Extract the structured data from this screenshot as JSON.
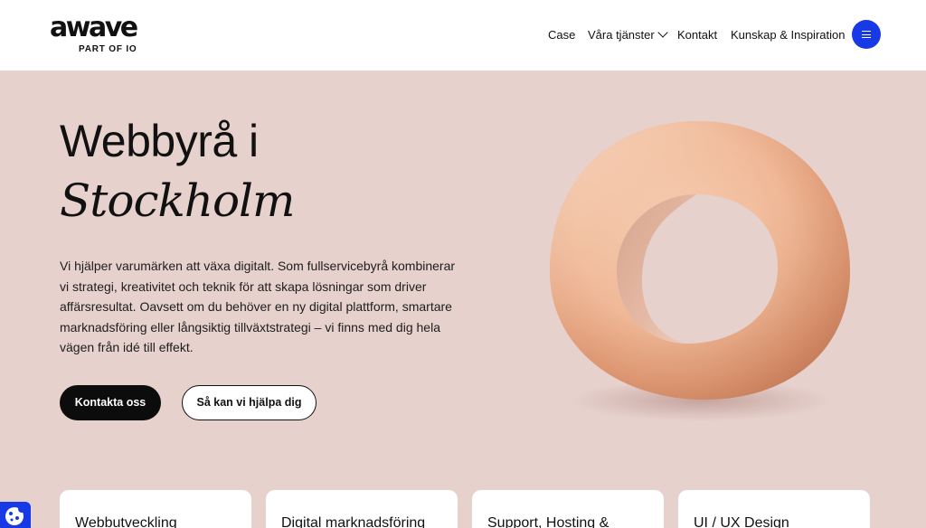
{
  "header": {
    "logo_word": "awave",
    "logo_sub": "PART OF IO",
    "nav": [
      {
        "label": "Case"
      },
      {
        "label": "Våra tjänster"
      },
      {
        "label": "Kontakt"
      },
      {
        "label": "Kunskap & Inspiration"
      }
    ],
    "menu_icon": "hamburger-icon"
  },
  "hero": {
    "title_line1": "Webbyrå i",
    "title_line2": "Stockholm",
    "text": "Vi hjälper varumärken att växa digitalt. Som fullservicebyrå kombinerar vi strategi, kreativitet och teknik för att skapa lösningar som driver affärsresultat. Oavsett om du behöver en ny digital plattform, smartare marknadsföring eller långsiktig tillväxtstrategi – vi finns med dig hela vägen från idé till effekt.",
    "primary_cta": "Kontakta oss",
    "secondary_cta": "Så kan vi hjälpa dig"
  },
  "cards": [
    {
      "title": "Webbutveckling"
    },
    {
      "title": "Digital marknadsföring"
    },
    {
      "title": "Support, Hosting &"
    },
    {
      "title": "UI / UX Design"
    }
  ],
  "colors": {
    "background": "#e6d1cd",
    "accent": "#1739e6",
    "ring": "#f0b899"
  },
  "cookie_icon": "cookie-icon"
}
